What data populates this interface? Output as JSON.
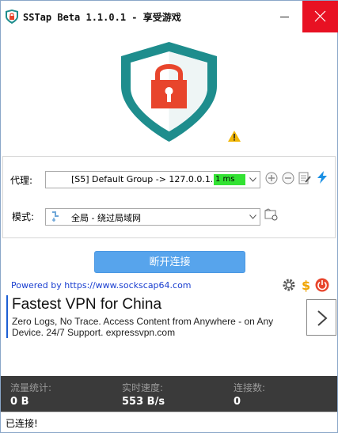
{
  "window": {
    "title": "SSTap Beta 1.1.0.1 - 享受游戏"
  },
  "icons": {
    "app": "shield-app-icon",
    "minimize": "minimize-icon",
    "close": "close-icon",
    "shield": "shield-lock-icon",
    "warning": "warning-icon",
    "add": "plus-circle-icon",
    "remove": "minus-circle-icon",
    "edit": "edit-icon",
    "lightning": "lightning-icon",
    "globe": "globe-icon",
    "rules": "rules-folder-icon",
    "settings": "gear-icon",
    "donate": "dollar-icon",
    "power": "power-icon",
    "next": "chevron-right-icon"
  },
  "colors": {
    "shield_teal": "#1e8d8d",
    "lock_red": "#e8452c",
    "close_red": "#e81123",
    "button_blue": "#57a4ec",
    "latency_green": "#33e233",
    "stats_bg": "#3a3a3a",
    "link_blue": "#1a3fd0"
  },
  "proxy": {
    "label": "代理:",
    "value": "[S5] Default Group -> 127.0.0.1...",
    "latency": "1 ms"
  },
  "mode": {
    "label": "模式:",
    "value": "全局 - 绕过局域网"
  },
  "disconnect_button": "断开连接",
  "powered_by": "Powered by https://www.sockscap64.com",
  "ad": {
    "title": "Fastest VPN for China",
    "body": "Zero Logs, No Trace. Access Content from Anywhere - on Any Device. 24/7 Support. expressvpn.com"
  },
  "stats": {
    "traffic_label": "流量统计:",
    "traffic_value": "0 B",
    "speed_label": "实时速度:",
    "speed_value": "553 B/s",
    "connections_label": "连接数:",
    "connections_value": "0"
  },
  "status": "已连接!"
}
